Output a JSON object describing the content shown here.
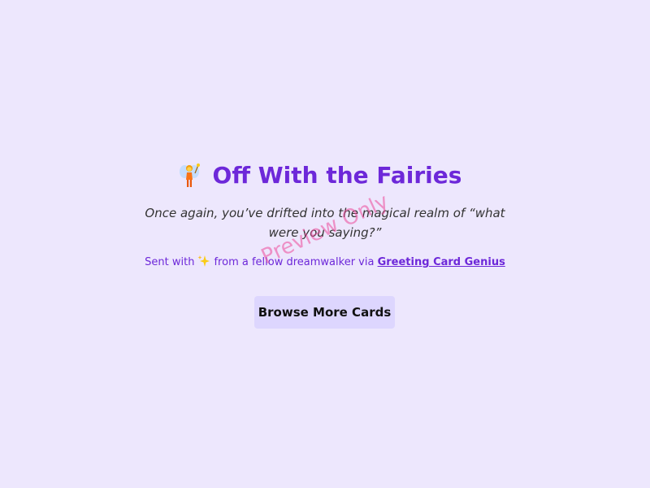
{
  "card": {
    "title": "Off With the Fairies",
    "message": "Once again, you’ve drifted into the magical realm of “what were you saying?”",
    "sent_prefix": "Sent with",
    "sent_middle": "from a fellow dreamwalker via",
    "sent_link": "Greeting Card Genius",
    "button_label": "Browse More Cards",
    "icons": [
      "fairy-icon",
      "sparkle-icon"
    ]
  },
  "watermark": "Preview Only",
  "colors": {
    "background": "#ede7fd",
    "accent": "#6d28d9",
    "button_bg": "#ddd6fe",
    "watermark": "#ec4899"
  }
}
